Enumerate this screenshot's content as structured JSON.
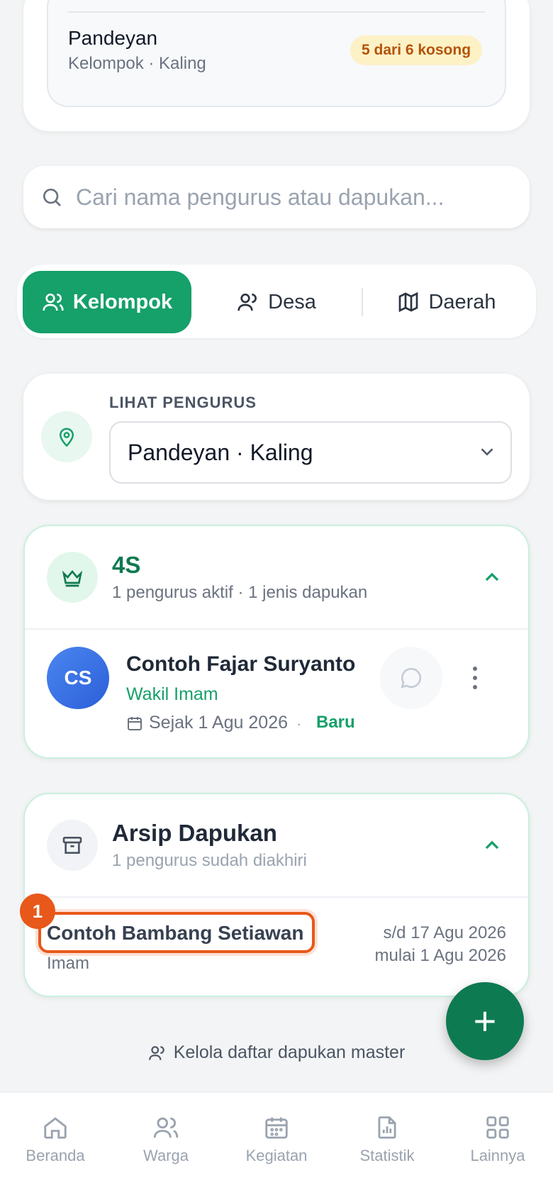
{
  "top_card": {
    "name": "Pandeyan",
    "sub": "Kelompok · Kaling",
    "badge": "5 dari 6 kosong"
  },
  "search": {
    "placeholder": "Cari nama pengurus atau dapukan..."
  },
  "segments": {
    "kelompok": "Kelompok",
    "desa": "Desa",
    "daerah": "Daerah"
  },
  "location": {
    "label": "LIHAT PENGURUS",
    "value": "Pandeyan · Kaling"
  },
  "group_4s": {
    "title": "4S",
    "subtitle": "1 pengurus aktif · 1 jenis dapukan",
    "member": {
      "initials": "CS",
      "name": "Contoh Fajar Suryanto",
      "role": "Wakil Imam",
      "since": "Sejak 1 Agu 2026",
      "separator": "·",
      "badge": "Baru"
    }
  },
  "archive": {
    "title": "Arsip Dapukan",
    "subtitle": "1 pengurus sudah diakhiri",
    "member": {
      "name": "Contoh Bambang Setiawan",
      "role": "Imam",
      "until": "s/d 17 Agu 2026",
      "from": "mulai 1 Agu 2026"
    },
    "highlight_number": "1"
  },
  "fab": {
    "label": "+"
  },
  "manage_link": "Kelola daftar dapukan master",
  "nav": {
    "home": "Beranda",
    "warga": "Warga",
    "kegiatan": "Kegiatan",
    "statistik": "Statistik",
    "lainnya": "Lainnya"
  },
  "colors": {
    "accent": "#16a06a",
    "accent_dark": "#0e7a52",
    "highlight": "#e8581a",
    "badge_bg": "#fdf1c6"
  }
}
